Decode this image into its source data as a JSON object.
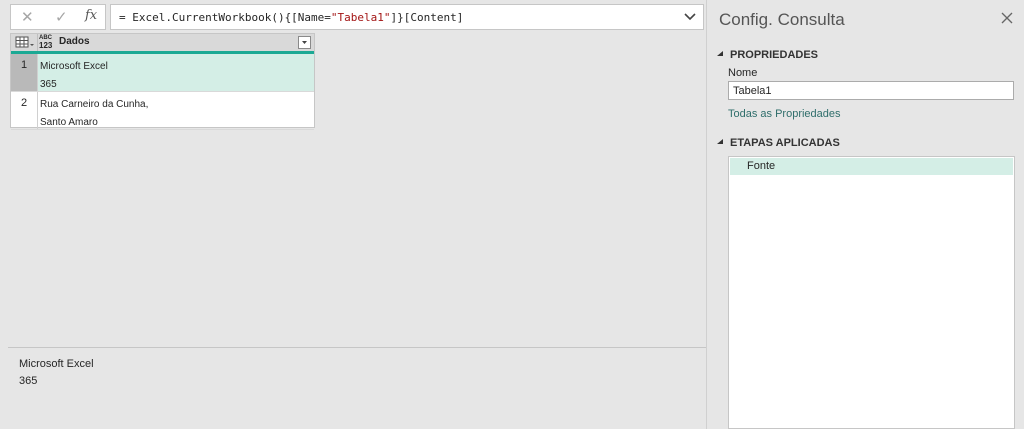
{
  "formula_bar": {
    "cancel_icon": "close-x-icon",
    "confirm_icon": "check-icon",
    "fx_label": "fx",
    "formula_prefix": "= Excel.CurrentWorkbook(){[Name=",
    "formula_string": "\"Tabela1\"",
    "formula_suffix": "]}[Content]"
  },
  "grid": {
    "column": {
      "type_line1": "ABC",
      "type_line2": "123",
      "name": "Dados"
    },
    "rows": [
      {
        "num": "1",
        "value": "Microsoft Excel\n365",
        "selected": true
      },
      {
        "num": "2",
        "value": "Rua Carneiro da Cunha,\nSanto Amaro",
        "selected": false
      }
    ]
  },
  "preview": {
    "value": "Microsoft Excel\n365"
  },
  "query_settings": {
    "title": "Config. Consulta",
    "properties_header": "PROPRIEDADES",
    "name_label": "Nome",
    "name_value": "Tabela1",
    "all_properties_link": "Todas as Propriedades",
    "applied_steps_header": "ETAPAS APLICADAS",
    "steps": [
      "Fonte"
    ]
  },
  "colors": {
    "accent": "#1ba994",
    "selected_row": "#d4eee6"
  }
}
